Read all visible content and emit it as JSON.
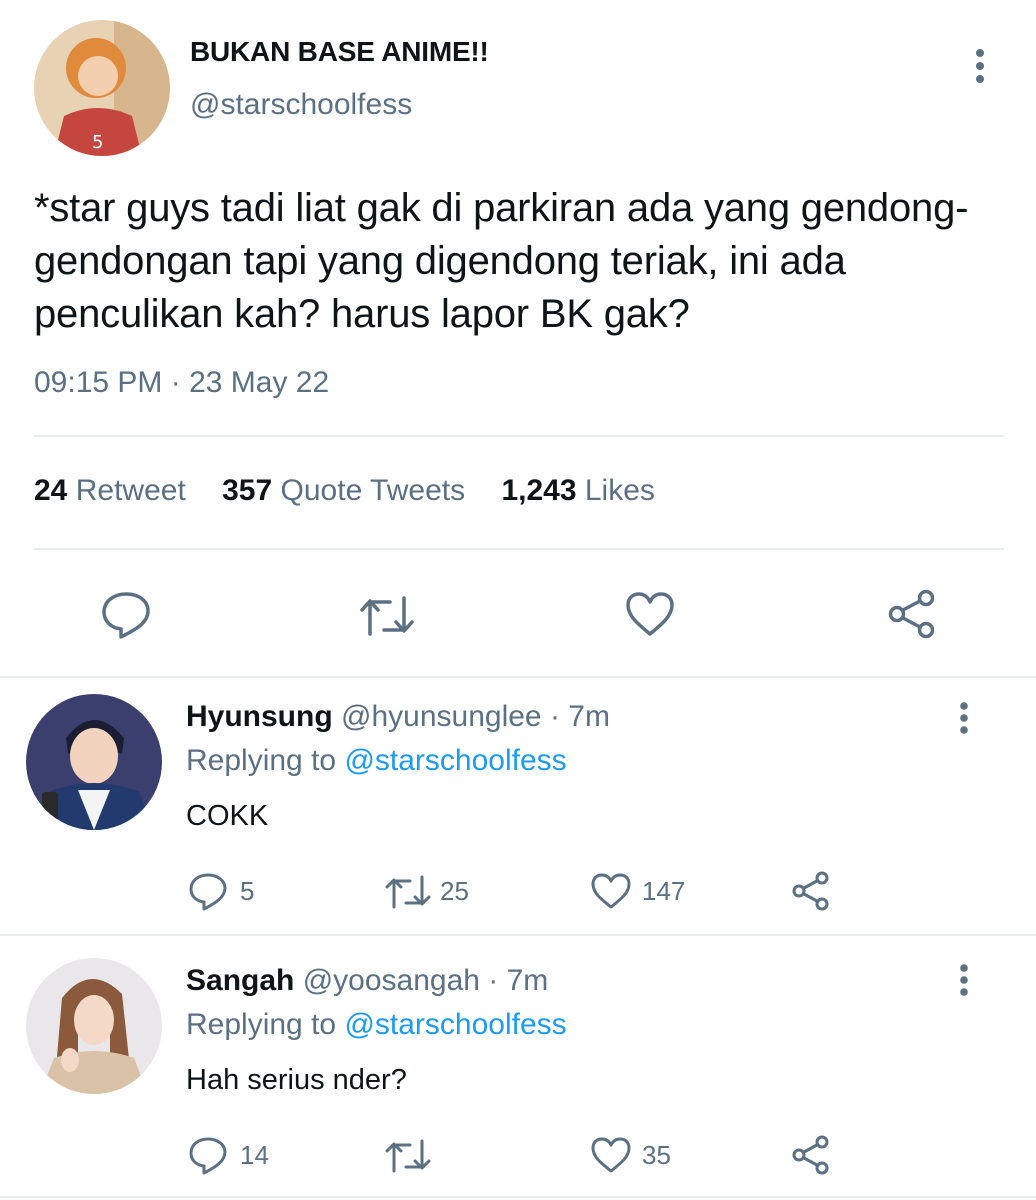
{
  "tweet": {
    "display_name": "BUKAN BASE ANIME!!",
    "handle": "@starschoolfess",
    "text": "*star guys tadi liat gak di parkiran ada yang gendong-gendongan tapi yang digendong teriak, ini ada penculikan kah? harus lapor BK gak?",
    "timestamp": "09:15 PM · 23 May 22",
    "stats": {
      "retweets": "24",
      "retweets_label": "Retweet",
      "quotes": "357",
      "quotes_label": "Quote Tweets",
      "likes": "1,243",
      "likes_label": "Likes"
    }
  },
  "replies": [
    {
      "display_name": "Hyunsung",
      "handle": "@hyunsunglee",
      "time": "· 7m",
      "replying_label": "Replying to",
      "replying_to": "@starschoolfess",
      "text": "COKK",
      "counts": {
        "replies": "5",
        "retweets": "25",
        "likes": "147"
      }
    },
    {
      "display_name": "Sangah",
      "handle": "@yoosangah",
      "time": "· 7m",
      "replying_label": "Replying to",
      "replying_to": "@starschoolfess",
      "text": "Hah serius nder?",
      "counts": {
        "replies": "14",
        "retweets": "",
        "likes": "35"
      }
    }
  ],
  "icons": {
    "reply": "speech-bubble",
    "retweet": "retweet-arrows",
    "like": "heart",
    "share": "share-nodes",
    "more": "vertical-dots"
  },
  "colors": {
    "text": "#0f1419",
    "secondary": "#5b7083",
    "link": "#1d9bf0",
    "divider": "#e6ecf0"
  }
}
